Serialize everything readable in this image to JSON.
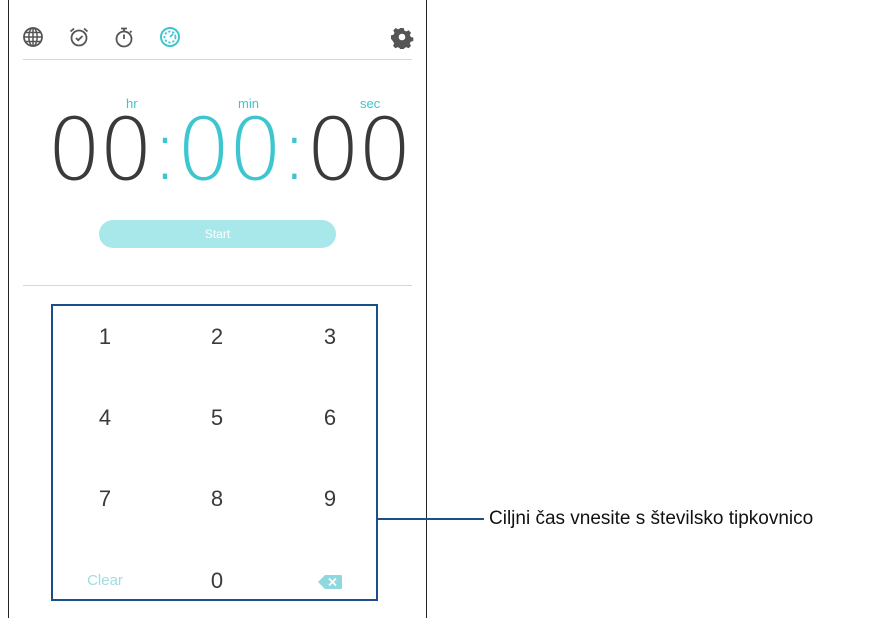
{
  "tabs": [
    {
      "name": "world-clock",
      "icon": "globe-icon"
    },
    {
      "name": "alarm",
      "icon": "alarm-clock-icon"
    },
    {
      "name": "stopwatch",
      "icon": "stopwatch-icon"
    },
    {
      "name": "timer",
      "icon": "timer-icon",
      "active": true
    }
  ],
  "settings_icon": "gear-icon",
  "labels": {
    "hr": "hr",
    "min": "min",
    "sec": "sec"
  },
  "time": {
    "hours": "00",
    "minutes": "00",
    "seconds": "00",
    "separator": ":"
  },
  "start_label": "Start",
  "keypad": {
    "keys": [
      "1",
      "2",
      "3",
      "4",
      "5",
      "6",
      "7",
      "8",
      "9"
    ],
    "clear_label": "Clear",
    "zero": "0",
    "backspace_icon": "backspace-icon"
  },
  "callout": "Ciljni čas vnesite s številsko tipkovnico",
  "colors": {
    "accent": "#3ec6d0",
    "start_button": "#a8e8eb",
    "annotation": "#1b4f8a",
    "digits": "#3a3a3a"
  }
}
